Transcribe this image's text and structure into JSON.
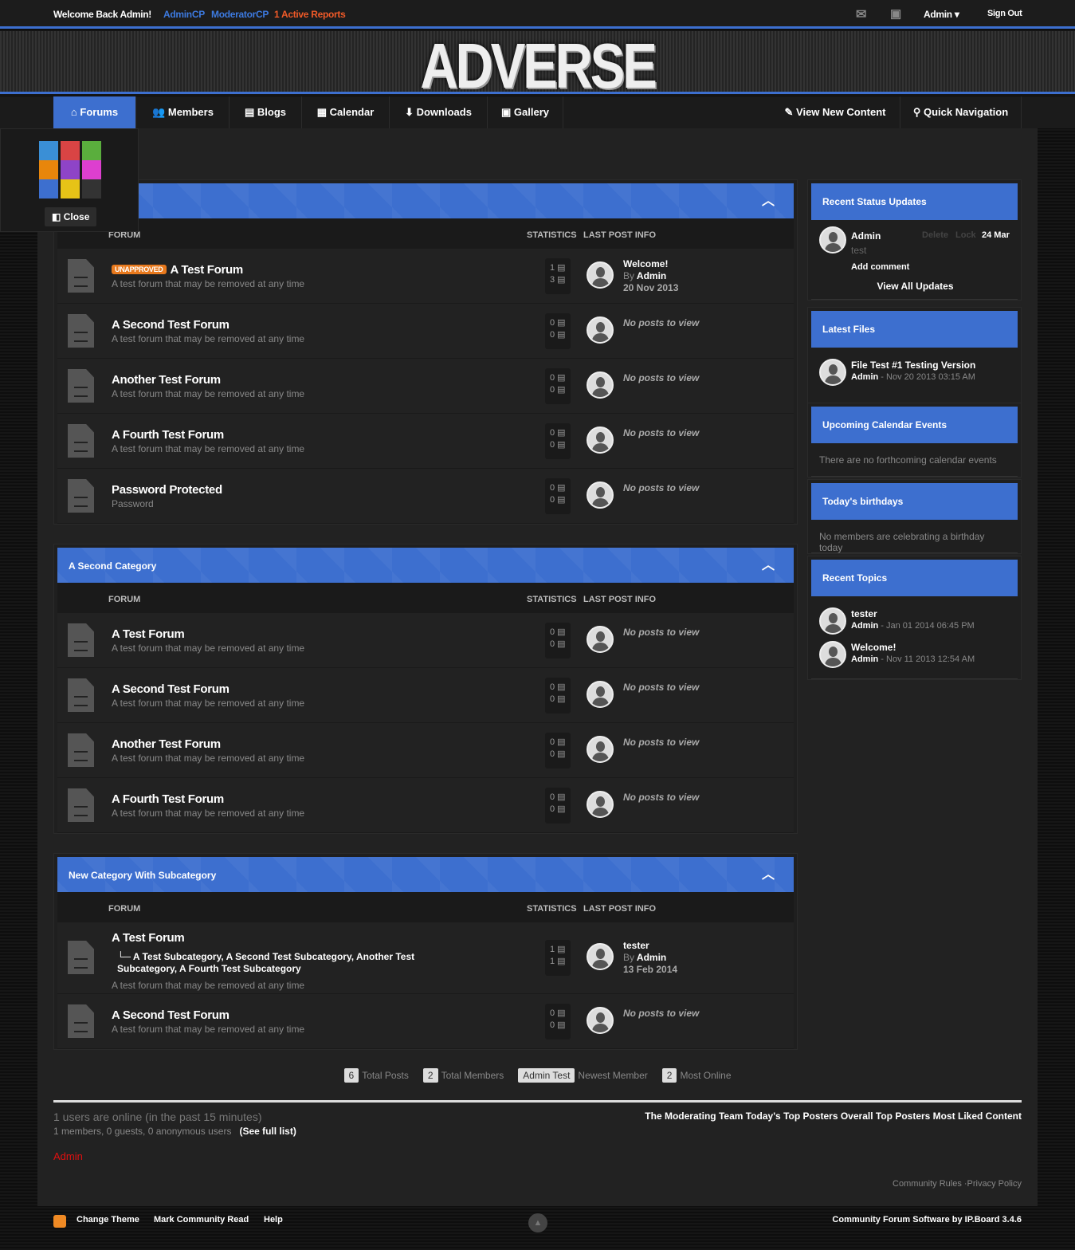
{
  "topbar": {
    "welcome": "Welcome Back Admin!",
    "admincp": "AdminCP",
    "modcp": "ModeratorCP",
    "reports": "1 Active Reports",
    "user": "Admin ▾",
    "signout": "Sign Out",
    "icons": [
      "envelope-icon",
      "contact-card-icon"
    ]
  },
  "logo": "ADVERSE",
  "nav": [
    {
      "label": "Forums",
      "icon": "⌂"
    },
    {
      "label": "Members",
      "icon": "👥"
    },
    {
      "label": "Blogs",
      "icon": "▤"
    },
    {
      "label": "Calendar",
      "icon": "▦"
    },
    {
      "label": "Downloads",
      "icon": "⬇"
    },
    {
      "label": "Gallery",
      "icon": "▣"
    },
    {
      "label": "View New Content",
      "icon": "✎"
    },
    {
      "label": "Quick Navigation",
      "icon": "⚲"
    }
  ],
  "palette": {
    "colors": [
      "#3a8fd6",
      "#d94444",
      "#5aae3d",
      "#e8860b",
      "#8e44c7",
      "#dd3fcf",
      "#3d6fcf",
      "#e6c317",
      "#333333"
    ],
    "close": "Close"
  },
  "columns": {
    "forum": "FORUM",
    "stats": "STATISTICS",
    "lastpost": "LAST POST INFO"
  },
  "noposts": "No posts to view",
  "by": "By",
  "categories": [
    {
      "title": "",
      "forums": [
        {
          "name": "A Test Forum",
          "badge": "UNAPPROVED",
          "desc": "A test forum that may be removed at any time",
          "topics": "1",
          "posts": "3",
          "last": {
            "title": "Welcome!",
            "author": "Admin",
            "date": "20 Nov 2013"
          }
        },
        {
          "name": "A Second Test Forum",
          "desc": "A test forum that may be removed at any time",
          "topics": "0",
          "posts": "0"
        },
        {
          "name": "Another Test Forum",
          "desc": "A test forum that may be removed at any time",
          "topics": "0",
          "posts": "0"
        },
        {
          "name": "A Fourth Test Forum",
          "desc": "A test forum that may be removed at any time",
          "topics": "0",
          "posts": "0"
        },
        {
          "name": "Password Protected",
          "desc": "Password",
          "topics": "0",
          "posts": "0"
        }
      ]
    },
    {
      "title": "A Second Category",
      "forums": [
        {
          "name": "A Test Forum",
          "desc": "A test forum that may be removed at any time",
          "topics": "0",
          "posts": "0"
        },
        {
          "name": "A Second Test Forum",
          "desc": "A test forum that may be removed at any time",
          "topics": "0",
          "posts": "0"
        },
        {
          "name": "Another Test Forum",
          "desc": "A test forum that may be removed at any time",
          "topics": "0",
          "posts": "0"
        },
        {
          "name": "A Fourth Test Forum",
          "desc": "A test forum that may be removed at any time",
          "topics": "0",
          "posts": "0"
        }
      ]
    },
    {
      "title": "New Category With Subcategory",
      "forums": [
        {
          "name": "A Test Forum",
          "subforums": [
            "A Test Subcategory",
            "A Second Test Subcategory",
            "Another Test Subcategory",
            "A Fourth Test Subcategory"
          ],
          "desc": "A test forum that may be removed at any time",
          "topics": "1",
          "posts": "1",
          "last": {
            "title": "tester",
            "author": "Admin",
            "date": "13 Feb 2014"
          }
        },
        {
          "name": "A Second Test Forum",
          "desc": "A test forum that may be removed at any time",
          "topics": "0",
          "posts": "0"
        }
      ]
    }
  ],
  "sidebar": {
    "status": {
      "title": "Recent Status Updates",
      "author": "Admin",
      "delete": "Delete",
      "lock": "Lock",
      "date": "24 Mar",
      "text": "test",
      "add_comment": "Add comment",
      "view_all": "View All Updates"
    },
    "files": {
      "title": "Latest Files",
      "items": [
        {
          "name": "File Test #1 Testing Version",
          "author": "Admin",
          "date": "Nov 20 2013 03:15 AM"
        }
      ]
    },
    "calendar": {
      "title": "Upcoming Calendar Events",
      "text": "There are no forthcoming calendar events"
    },
    "birthdays": {
      "title": "Today's birthdays",
      "text": "No members are celebrating a birthday today"
    },
    "topics": {
      "title": "Recent Topics",
      "items": [
        {
          "name": "tester",
          "author": "Admin",
          "date": "Jan 01 2014 06:45 PM"
        },
        {
          "name": "Welcome!",
          "author": "Admin",
          "date": "Nov 11 2013 12:54 AM"
        }
      ]
    }
  },
  "stats": [
    {
      "value": "6",
      "label": "Total Posts"
    },
    {
      "value": "2",
      "label": "Total Members"
    },
    {
      "value": "Admin Test",
      "label": "Newest Member"
    },
    {
      "value": "2",
      "label": "Most Online"
    }
  ],
  "online": {
    "title": "1 users are online (in the past 15 minutes)",
    "detail": "1 members, 0 guests, 0 anonymous users",
    "full": "(See full list)",
    "user": "Admin",
    "links": "The Moderating Team Today's Top Posters Overall Top Posters Most Liked Content",
    "rules": "Community Rules ·Privacy Policy"
  },
  "footer": {
    "theme": "Change Theme",
    "mark": "Mark Community Read",
    "help": "Help",
    "credit": "Community Forum Software by IP.Board 3.4.6"
  }
}
